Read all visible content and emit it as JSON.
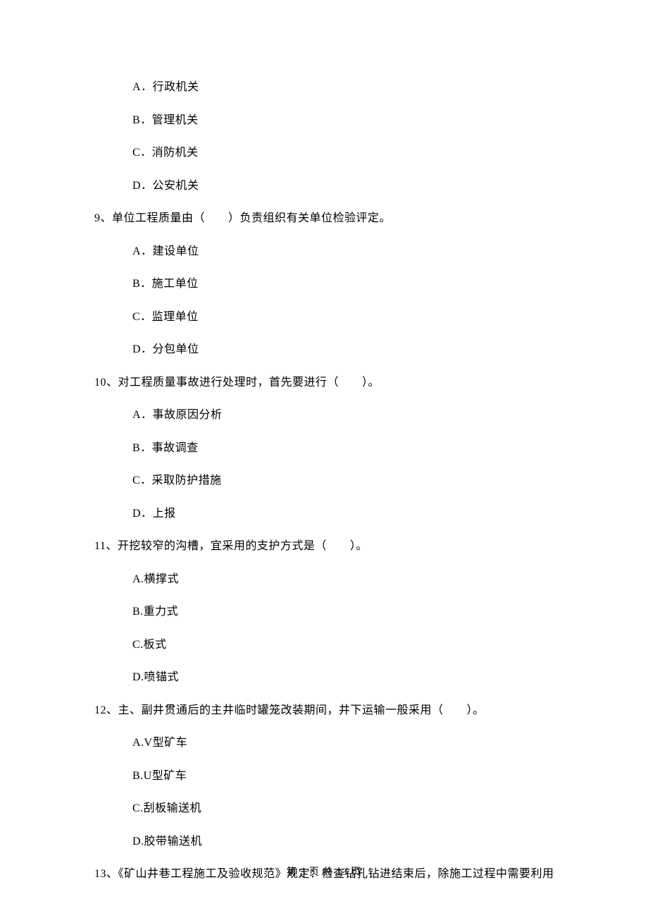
{
  "q8": {
    "options": {
      "a": "A．行政机关",
      "b": "B．管理机关",
      "c": "C．消防机关",
      "d": "D．公安机关"
    }
  },
  "q9": {
    "text": "9、单位工程质量由（　　）负责组织有关单位检验评定。",
    "options": {
      "a": "A．建设单位",
      "b": "B．施工单位",
      "c": "C．监理单位",
      "d": "D．分包单位"
    }
  },
  "q10": {
    "text": "10、对工程质量事故进行处理时，首先要进行（　　）。",
    "options": {
      "a": "A．事故原因分析",
      "b": "B．事故调查",
      "c": "C．采取防护措施",
      "d": "D．上报"
    }
  },
  "q11": {
    "text": "11、开挖较窄的沟槽，宜采用的支护方式是（　　）。",
    "options": {
      "a": "A.横撑式",
      "b": "B.重力式",
      "c": "C.板式",
      "d": "D.喷锚式"
    }
  },
  "q12": {
    "text": "12、主、副井贯通后的主井临时罐笼改装期间，井下运输一般采用（　　）。",
    "options": {
      "a": "A.V型矿车",
      "b": "B.U型矿车",
      "c": "C.刮板输送机",
      "d": "D.胶带输送机"
    }
  },
  "q13": {
    "text": "13、《矿山井巷工程施工及验收规范》规定：检查钻孔钻进结束后，除施工过程中需要利用"
  },
  "footer": "第 3 页 共 13 页"
}
